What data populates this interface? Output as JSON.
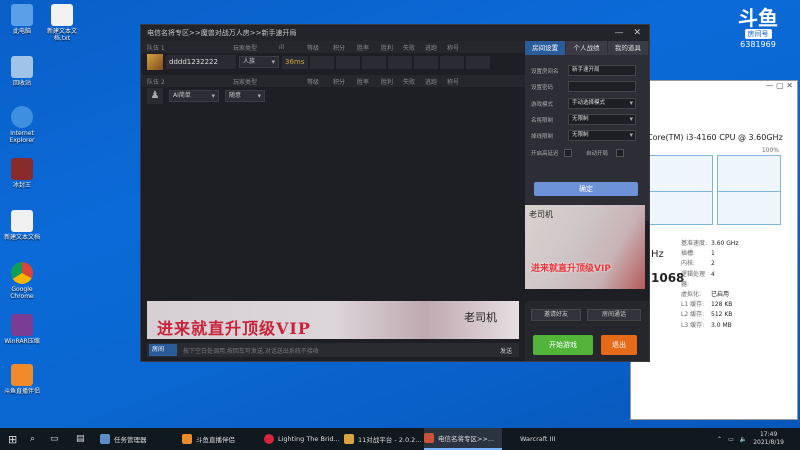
{
  "desktop": {
    "icons": [
      {
        "label": "此电脑",
        "color": "#5aa0e6"
      },
      {
        "label": "新建文本文档.txt",
        "color": "#f2f2f2"
      },
      {
        "label": "回收站",
        "color": "#9fc4e8"
      },
      {
        "label": "Internet Explorer",
        "color": "#3d8fe0"
      },
      {
        "label": "冰封王",
        "color": "#8a2b2b"
      },
      {
        "label": "新建文本文档",
        "color": "#f0f0f0"
      },
      {
        "label": "Google Chrome",
        "color": "#e9b530"
      },
      {
        "label": "WinRAR压缩",
        "color": "#7a3d92"
      },
      {
        "label": "斗鱼直播伴侣",
        "color": "#f08a2a"
      }
    ]
  },
  "brand": {
    "logo": "斗鱼",
    "sub": "房间号",
    "room": "6381969"
  },
  "taskmgr": {
    "cpu_name": "Core(TM) i3-4160 CPU @ 3.60GHz",
    "pct": "100%",
    "hz": "Hz",
    "big": "1068",
    "specs": [
      {
        "k": "基准速度:",
        "v": "3.60 GHz"
      },
      {
        "k": "插槽:",
        "v": "1"
      },
      {
        "k": "内核:",
        "v": "2"
      },
      {
        "k": "逻辑处理器:",
        "v": "4"
      },
      {
        "k": "虚拟化:",
        "v": "已启用"
      },
      {
        "k": "L1 缓存:",
        "v": "128 KB"
      },
      {
        "k": "L2 缓存:",
        "v": "512 KB"
      },
      {
        "k": "L3 缓存:",
        "v": "3.0 MB"
      }
    ]
  },
  "game": {
    "title": "电信名将专区>>魔兽对战万人房>>新手速开局",
    "team1": {
      "label": "队伍 1",
      "cols": [
        "玩家类型",
        "ıll",
        "等级",
        "积分",
        "胜率",
        "胜利",
        "失败",
        "逃跑",
        "称号"
      ]
    },
    "player1": {
      "name": "dddd1232222",
      "type": "人族",
      "ping": "36ms"
    },
    "team2": {
      "label": "队伍 2",
      "cols": [
        "玩家类型",
        "等级",
        "积分",
        "胜率",
        "胜利",
        "失败",
        "逃跑",
        "称号"
      ]
    },
    "player2": {
      "type": "AI简单",
      "race": "随意"
    },
    "tabs": [
      "房间设置",
      "个人战绩",
      "我的道具"
    ],
    "settings": [
      {
        "label": "设置房间名",
        "value": "新手速开局"
      },
      {
        "label": "设置密码",
        "value": ""
      },
      {
        "label": "游戏模式",
        "value": "手动选择模式"
      },
      {
        "label": "名将限制",
        "value": "无限制"
      },
      {
        "label": "掉线限制",
        "value": "无限制"
      }
    ],
    "checks": [
      "开启高延迟",
      "自动开局"
    ],
    "confirm": "确定",
    "ad_brand": "老司机",
    "ad_slogan": "进来就直升顶级VIP",
    "side_btns": [
      "邀请好友",
      "房间通话"
    ],
    "start": "开始游戏",
    "quit": "退出",
    "chat": {
      "channel": "房间",
      "hint": "按下空白处调用,按回车可发送,对话送出系统不接收",
      "send": "发送"
    }
  },
  "taskbar": {
    "items": [
      {
        "label": "任务管理器",
        "color": "#5a8fc8"
      },
      {
        "label": "斗鱼直播伴侣",
        "color": "#f08a2a"
      },
      {
        "label": "Lighting The Brid...",
        "color": "#d6263b"
      },
      {
        "label": "11对战平台 - 2.0.2...",
        "color": "#d9a444"
      },
      {
        "label": "电信名将专区>>...",
        "color": "#c9533a"
      },
      {
        "label": "Warcraft III",
        "color": "#444"
      }
    ],
    "time": "17:49",
    "date": "2021/8/19"
  }
}
